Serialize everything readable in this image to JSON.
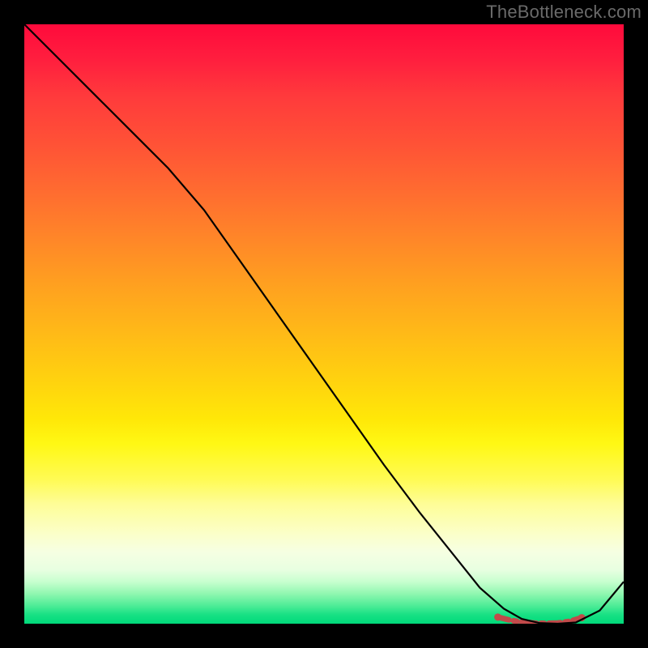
{
  "watermark": "TheBottleneck.com",
  "chart_data": {
    "type": "line",
    "title": "",
    "xlabel": "",
    "ylabel": "",
    "xlim": [
      0,
      100
    ],
    "ylim": [
      0,
      100
    ],
    "grid": false,
    "series": [
      {
        "name": "curve",
        "x": [
          0,
          6,
          12,
          18,
          24,
          30,
          36,
          42,
          48,
          54,
          60,
          66,
          72,
          76,
          80,
          83,
          86,
          89,
          92,
          96,
          100
        ],
        "y": [
          100,
          94,
          88,
          82,
          76,
          69,
          60.5,
          52,
          43.5,
          35,
          26.5,
          18.5,
          11,
          6,
          2.5,
          0.8,
          0.1,
          0,
          0.2,
          2.2,
          7
        ]
      },
      {
        "name": "minimum-band",
        "x": [
          79,
          81,
          83,
          85,
          87,
          89,
          91,
          93
        ],
        "y": [
          1.1,
          0.6,
          0.25,
          0.1,
          0.05,
          0.1,
          0.4,
          1.0
        ]
      }
    ],
    "colors": {
      "curve": "#000000",
      "minimum_band": "#c24a4a"
    }
  }
}
